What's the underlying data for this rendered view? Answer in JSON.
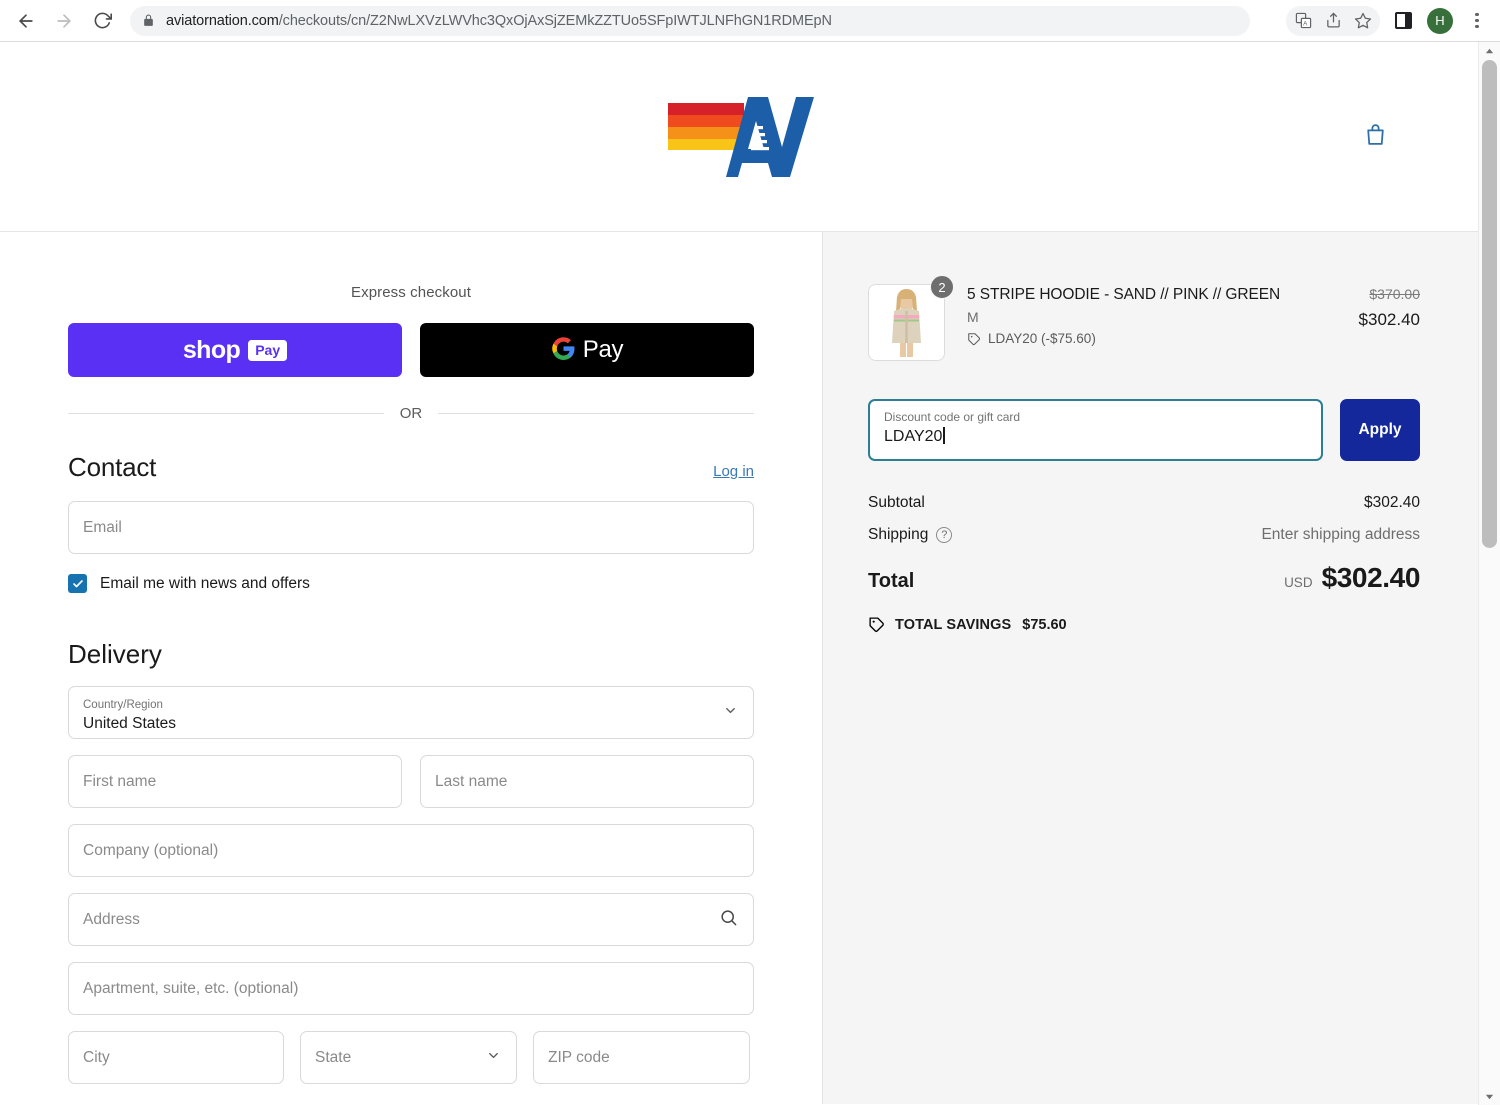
{
  "browser": {
    "url_domain": "aviatornation.com",
    "url_path": "/checkouts/cn/Z2NwLXVzLWVhc3QxOjAxSjZEMkZZTUo5SFpIWTJLNFhGN1RDMEpN",
    "back_icon": "back-arrow-icon",
    "forward_icon": "forward-arrow-icon",
    "reload_icon": "reload-icon",
    "lock_icon": "lock-icon",
    "translate_icon": "translate-icon",
    "share_icon": "share-icon",
    "bookmark_icon": "star-icon",
    "sidebar_icon": "side-panel-icon",
    "profile_initial": "H",
    "menu_icon": "three-dot-menu-icon"
  },
  "site_header": {
    "logo_alt": "aviator-nation-logo",
    "cart_icon": "shopping-bag-icon"
  },
  "express": {
    "label": "Express checkout",
    "shop_pay": {
      "word": "shop",
      "chip": "Pay"
    },
    "google_pay": {
      "word": "Pay",
      "icon": "google-g-icon"
    },
    "or_text": "OR"
  },
  "contact": {
    "title": "Contact",
    "login_label": "Log in",
    "email_placeholder": "Email",
    "newsletter_label": "Email me with news and offers",
    "newsletter_checked": true
  },
  "delivery": {
    "title": "Delivery",
    "country": {
      "label": "Country/Region",
      "value": "United States"
    },
    "first_name_placeholder": "First name",
    "last_name_placeholder": "Last name",
    "company_placeholder": "Company (optional)",
    "address_placeholder": "Address",
    "address_icon": "search-icon",
    "apartment_placeholder": "Apartment, suite, etc. (optional)",
    "city_placeholder": "City",
    "state_placeholder": "State",
    "zip_placeholder": "ZIP code"
  },
  "summary": {
    "item": {
      "title": "5 STRIPE HOODIE - SAND // PINK // GREEN",
      "variant": "M",
      "discount_text": "LDAY20 (-$75.60)",
      "discount_icon": "tag-icon",
      "quantity": "2",
      "original_price": "$370.00",
      "price": "$302.40",
      "image_alt": "hoodie-product-thumbnail"
    },
    "discount": {
      "placeholder": "Discount code or gift card",
      "value": "LDAY20",
      "apply_label": "Apply"
    },
    "subtotal_label": "Subtotal",
    "subtotal_value": "$302.40",
    "shipping_label": "Shipping",
    "shipping_help_icon": "question-mark-icon",
    "shipping_value": "Enter shipping address",
    "total_label": "Total",
    "total_currency": "USD",
    "total_value": "$302.40",
    "savings_label": "TOTAL SAVINGS",
    "savings_value": "$75.60",
    "savings_icon": "tag-icon"
  },
  "colors": {
    "shop_pay_purple": "#5A31F4",
    "apply_navy": "#14279B",
    "focus_teal": "#2B7F94",
    "checkbox_blue": "#1773B0",
    "link_blue": "#3A7AB5",
    "logo_blue": "#1C5FA8",
    "sidebar_bg": "#F5F5F5"
  }
}
